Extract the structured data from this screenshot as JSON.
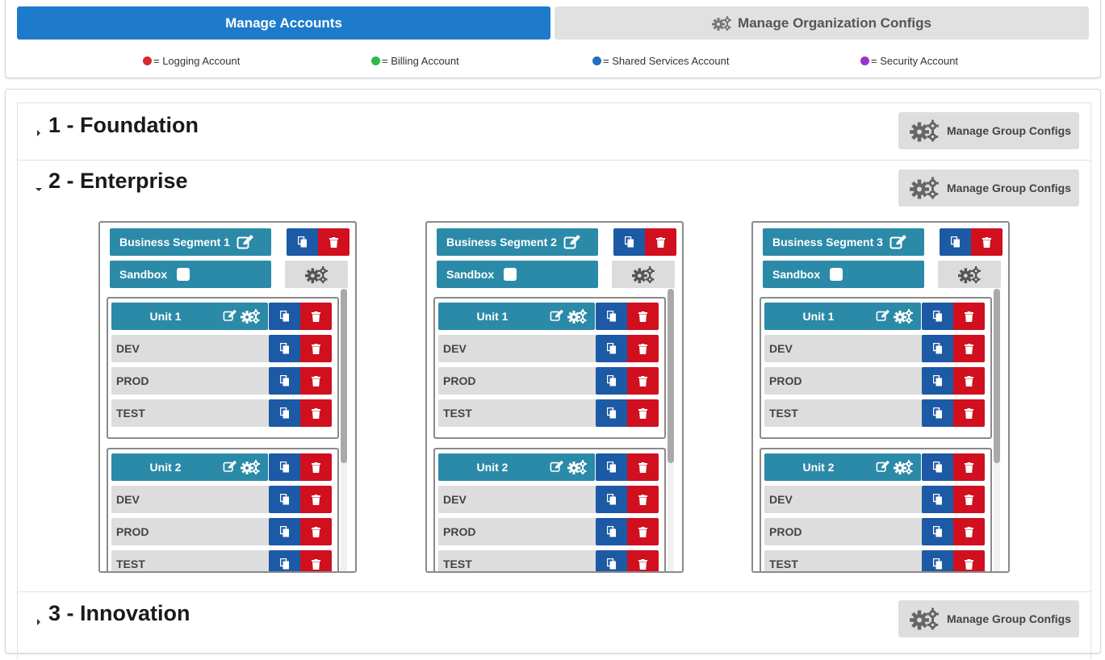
{
  "top_tabs": {
    "manage_accounts": "Manage Accounts",
    "manage_org_configs": "Manage Organization Configs"
  },
  "legend": [
    {
      "label": "= Logging Account",
      "color": "#d9282f"
    },
    {
      "label": "= Billing Account",
      "color": "#2db84a"
    },
    {
      "label": "= Shared Services Account",
      "color": "#1f6fc0"
    },
    {
      "label": "= Security Account",
      "color": "#9b33c9"
    }
  ],
  "groups": [
    {
      "title": "1 - Foundation",
      "expanded": false,
      "config_label": "Manage Group Configs"
    },
    {
      "title": "2 - Enterprise",
      "expanded": true,
      "config_label": "Manage Group Configs"
    },
    {
      "title": "3 - Innovation",
      "expanded": false,
      "config_label": "Manage Group Configs"
    }
  ],
  "segments": [
    {
      "name": "Business Segment 1",
      "sandbox_label": "Sandbox",
      "units": [
        {
          "name": "Unit 1",
          "envs": [
            "DEV",
            "PROD",
            "TEST"
          ]
        },
        {
          "name": "Unit 2",
          "envs": [
            "DEV",
            "PROD",
            "TEST"
          ]
        }
      ]
    },
    {
      "name": "Business Segment 2",
      "sandbox_label": "Sandbox",
      "units": [
        {
          "name": "Unit 1",
          "envs": [
            "DEV",
            "PROD",
            "TEST"
          ]
        },
        {
          "name": "Unit 2",
          "envs": [
            "DEV",
            "PROD",
            "TEST"
          ]
        }
      ]
    },
    {
      "name": "Business Segment 3",
      "sandbox_label": "Sandbox",
      "units": [
        {
          "name": "Unit 1",
          "envs": [
            "DEV",
            "PROD",
            "TEST"
          ]
        },
        {
          "name": "Unit 2",
          "envs": [
            "DEV",
            "PROD",
            "TEST"
          ]
        }
      ]
    }
  ],
  "colors": {
    "primary": "#1e7bcb",
    "segment_teal": "#2b8aa8",
    "copy_blue": "#1c5aa6",
    "delete_red": "#d0101e",
    "neutral_gray": "#dedede"
  },
  "icons": {
    "tab_org": "gears-icon",
    "group_config": "gears-icon",
    "edit": "edit-icon",
    "copy": "copy-icon",
    "delete": "trash-icon",
    "caret_collapsed": "caret-right-icon",
    "caret_expanded": "caret-down-icon"
  }
}
